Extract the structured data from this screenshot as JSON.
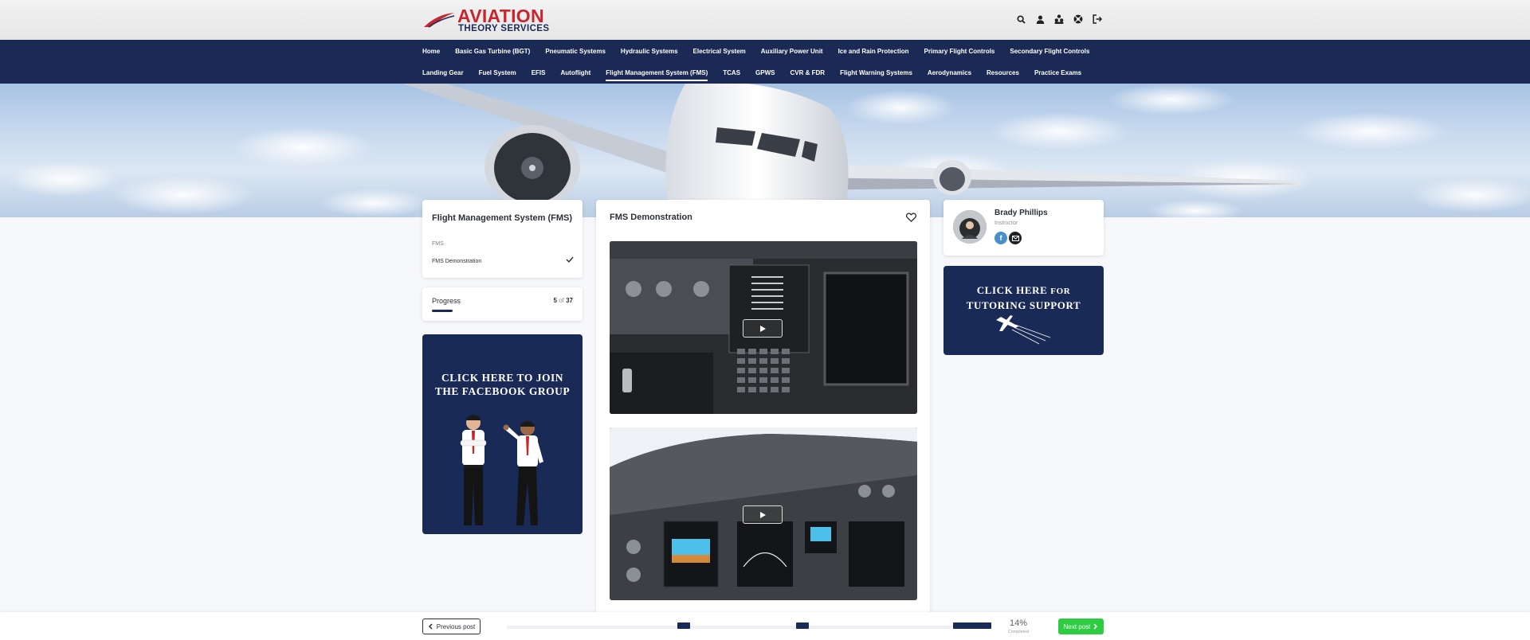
{
  "brand": {
    "line1": "AVIATION",
    "line2": "THEORY SERVICES"
  },
  "header_icons": [
    "search-icon",
    "user-icon",
    "users-group-icon",
    "support-icon",
    "logout-icon"
  ],
  "nav": {
    "row1": [
      "Home",
      "Basic Gas Turbine (BGT)",
      "Pneumatic Systems",
      "Hydraulic Systems",
      "Electrical System",
      "Auxiliary Power Unit",
      "Ice and Rain Protection",
      "Primary Flight Controls",
      "Secondary Flight Controls"
    ],
    "row2": [
      "Landing Gear",
      "Fuel System",
      "EFIS",
      "Autoflight",
      "Flight Management System (FMS)",
      "TCAS",
      "GPWS",
      "CVR & FDR",
      "Flight Warning Systems",
      "Aerodynamics",
      "Resources",
      "Practice Exams"
    ],
    "active": "Flight Management System (FMS)"
  },
  "lesson": {
    "title": "Flight Management System (FMS)",
    "section": "FMS",
    "item": "FMS Demonstration"
  },
  "progress": {
    "label": "Progress",
    "current": "5",
    "of": "of",
    "total": "37"
  },
  "facebook_banner": {
    "line1": "CLICK HERE TO JOIN",
    "line2": "THE FACEBOOK GROUP"
  },
  "main": {
    "title": "FMS Demonstration"
  },
  "instructor": {
    "name": "Brady Phillips",
    "role": "Instructor",
    "social_fb": "f"
  },
  "tutor_banner": {
    "line1_a": "CLICK HERE",
    "line1_b": "FOR",
    "line2": "TUTORING SUPPORT"
  },
  "footer": {
    "prev_label": "Previous post",
    "next_label": "Next post",
    "percent": "14%",
    "percent_label": "Completed"
  },
  "colors": {
    "navy": "#1b2a55",
    "brand_red": "#c8262e",
    "green": "#2ecc40"
  }
}
